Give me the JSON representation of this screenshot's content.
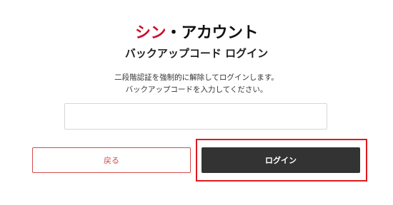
{
  "logo": {
    "red_part": "シン",
    "dark_part": "・アカウント"
  },
  "page": {
    "title": "バックアップコード ログイン"
  },
  "description": {
    "line1": "二段階認証を強制的に解除してログインします。",
    "line2": "バックアップコードを入力してください。"
  },
  "form": {
    "code_value": "",
    "code_placeholder": ""
  },
  "buttons": {
    "back_label": "戻る",
    "login_label": "ログイン"
  },
  "colors": {
    "brand_red": "#c8102e",
    "back_border": "#d24b4b",
    "login_bg": "#333333",
    "highlight": "#e0191e"
  }
}
